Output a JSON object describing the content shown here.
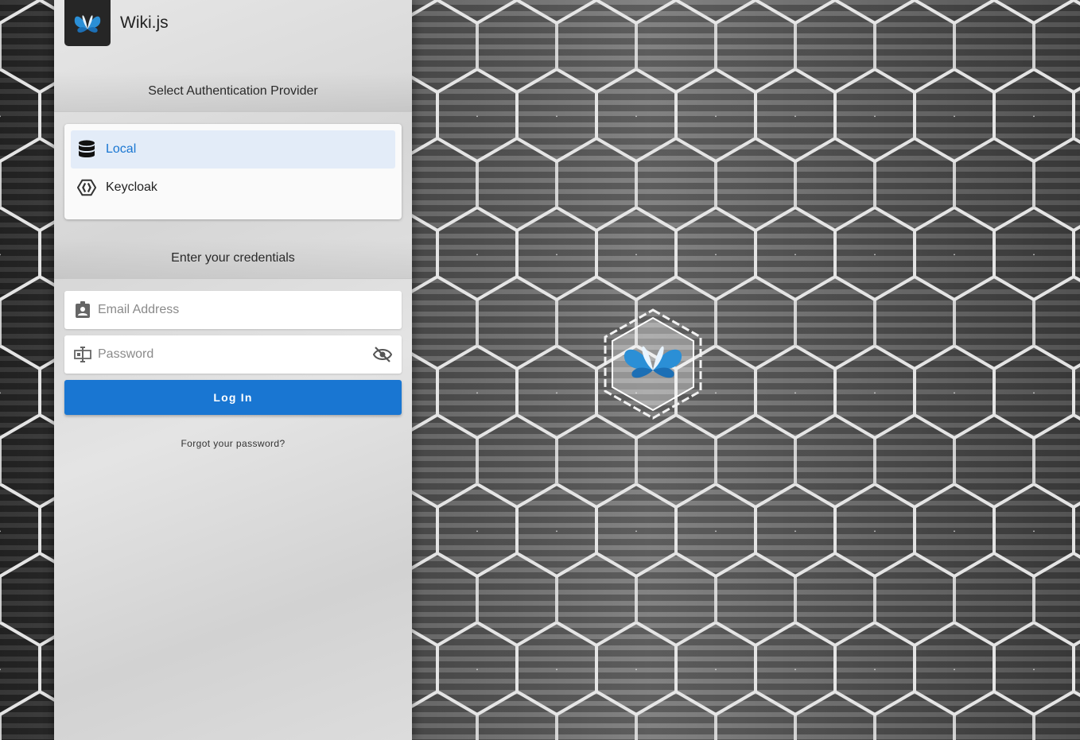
{
  "brand": {
    "name": "Wiki.js",
    "logo_icon": "wikijs-butterfly-icon"
  },
  "providers_section": {
    "title": "Select Authentication Provider",
    "items": [
      {
        "label": "Local",
        "icon": "database-icon",
        "selected": true
      },
      {
        "label": "Keycloak",
        "icon": "keycloak-icon",
        "selected": false
      }
    ]
  },
  "credentials_section": {
    "title": "Enter your credentials",
    "email": {
      "placeholder": "Email Address",
      "value": "",
      "icon": "contact-card-icon"
    },
    "password": {
      "placeholder": "Password",
      "value": "",
      "icon": "password-field-icon",
      "toggle_icon": "eye-off-icon"
    },
    "login_label": "Log In",
    "forgot_label": "Forgot your password?"
  },
  "colors": {
    "accent": "#1976d2",
    "selected_bg": "#e3ecf8",
    "logo_bg": "#262626"
  }
}
